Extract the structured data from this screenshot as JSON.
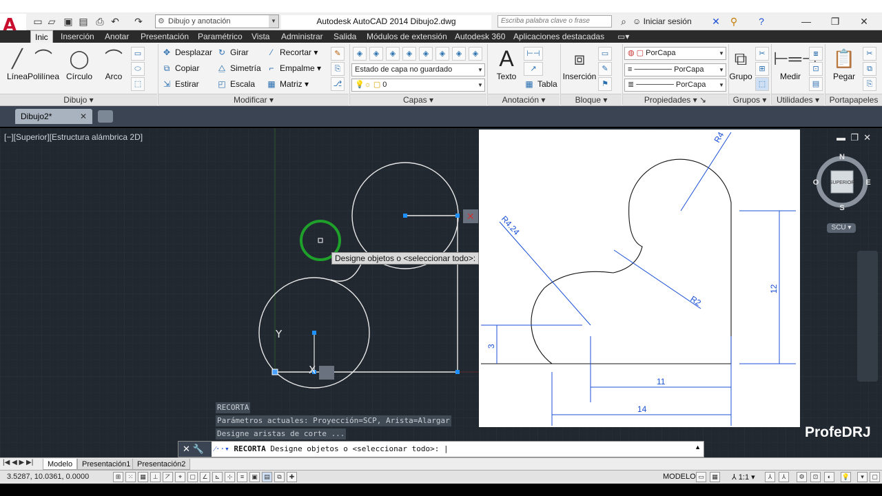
{
  "titlebar": {
    "workspace": "Dibujo y anotación",
    "app_title": "Autodesk AutoCAD 2014    Dibujo2.dwg",
    "search_placeholder": "Escriba palabra clave o frase",
    "signin": "Iniciar sesión"
  },
  "ribbon_tabs": [
    "Inic",
    "Inserción",
    "Anotar",
    "Presentación",
    "Paramétrico",
    "Vista",
    "Administrar",
    "Salida",
    "Módulos de extensión",
    "Autodesk 360",
    "Aplicaciones destacadas"
  ],
  "panels": {
    "dibujo": {
      "title": "Dibujo",
      "tools": [
        "Línea",
        "Polilínea",
        "Círculo",
        "Arco"
      ]
    },
    "modificar": {
      "title": "Modificar",
      "tools": [
        "Desplazar",
        "Girar",
        "Recortar",
        "Copiar",
        "Simetría",
        "Empalme",
        "Estirar",
        "Escala",
        "Matriz"
      ]
    },
    "capas": {
      "title": "Capas",
      "layer_state": "Estado de capa no guardado",
      "current_layer": "0"
    },
    "anotacion": {
      "title": "Anotación",
      "texto": "Texto",
      "tabla": "Tabla"
    },
    "bloque": {
      "title": "Bloque",
      "insercion": "Inserción"
    },
    "propiedades": {
      "title": "Propiedades",
      "color": "PorCapa",
      "linetype": "PorCapa",
      "lineweight": "PorCapa"
    },
    "grupos": {
      "title": "Grupos",
      "grupo": "Grupo"
    },
    "utilidades": {
      "title": "Utilidades",
      "medir": "Medir"
    },
    "portapapeles": {
      "title": "Portapapeles",
      "pegar": "Pegar"
    }
  },
  "file_tab": "Dibujo2*",
  "viewport_label": "[−][Superior][Estructura alámbrica 2D]",
  "tooltip": "Designe objetos o <seleccionar todo>:",
  "command_history": [
    "RECORTA",
    "Parámetros actuales: Proyección=SCP, Arista=Alargar",
    "Designe aristas de corte ..."
  ],
  "command_line": {
    "command": "RECORTA",
    "prompt": "Designe objetos o <seleccionar todo>: |"
  },
  "viewcube": {
    "n": "N",
    "s": "S",
    "e": "E",
    "o": "O",
    "face": "SUPERIOR",
    "ucs": "SCU"
  },
  "watermark": "ProfeDRJ",
  "reference_drawing": {
    "dims": {
      "r4": "R4",
      "r4_24": "R4.24",
      "r2": "R2",
      "d12": "12",
      "d3": "3",
      "d11": "11",
      "d14": "14"
    }
  },
  "layout_tabs": [
    "Modelo",
    "Presentación1",
    "Presentación2"
  ],
  "status": {
    "coords": "3.5287,  10.0361, 0.0000",
    "space": "MODELO",
    "scale": "1:1"
  },
  "colors": {
    "canvas": "#212830",
    "accent_green": "#1fa02b",
    "dimension_blue": "#1a4fd6"
  }
}
